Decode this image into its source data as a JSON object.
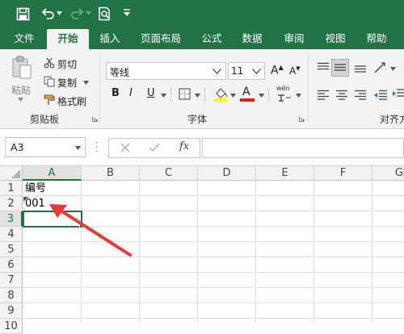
{
  "quick_access": {
    "icons": [
      "save-icon",
      "undo-icon",
      "redo-icon",
      "print-preview-icon",
      "customize-icon"
    ]
  },
  "tabs": [
    {
      "label": "文件",
      "active": false
    },
    {
      "label": "开始",
      "active": true
    },
    {
      "label": "插入",
      "active": false
    },
    {
      "label": "页面布局",
      "active": false
    },
    {
      "label": "公式",
      "active": false
    },
    {
      "label": "数据",
      "active": false
    },
    {
      "label": "审阅",
      "active": false
    },
    {
      "label": "视图",
      "active": false
    },
    {
      "label": "帮助",
      "active": false
    }
  ],
  "clipboard": {
    "paste_label": "粘贴",
    "cut_label": "剪切",
    "copy_label": "复制",
    "format_painter_label": "格式刷",
    "group_label": "剪贴板"
  },
  "font": {
    "font_name": "等线",
    "font_size": "11",
    "grow_label": "A",
    "shrink_label": "A",
    "bold_label": "B",
    "italic_label": "I",
    "underline_label": "U",
    "font_color_label": "A",
    "phonetic_label": "wén",
    "group_label": "字体"
  },
  "alignment": {
    "group_label": "对齐方"
  },
  "formula_bar": {
    "name_box": "A3",
    "fx_label": "fx",
    "value": ""
  },
  "sheet": {
    "columns": [
      "A",
      "B",
      "C",
      "D",
      "E",
      "F",
      "G"
    ],
    "rows": [
      "1",
      "2",
      "3",
      "4",
      "5",
      "6",
      "7",
      "8",
      "9",
      "10"
    ],
    "cells": {
      "A1": "编号",
      "A2": "001"
    },
    "selected": "A3"
  },
  "colors": {
    "brand": "#217346",
    "arrow": "#e53935"
  }
}
